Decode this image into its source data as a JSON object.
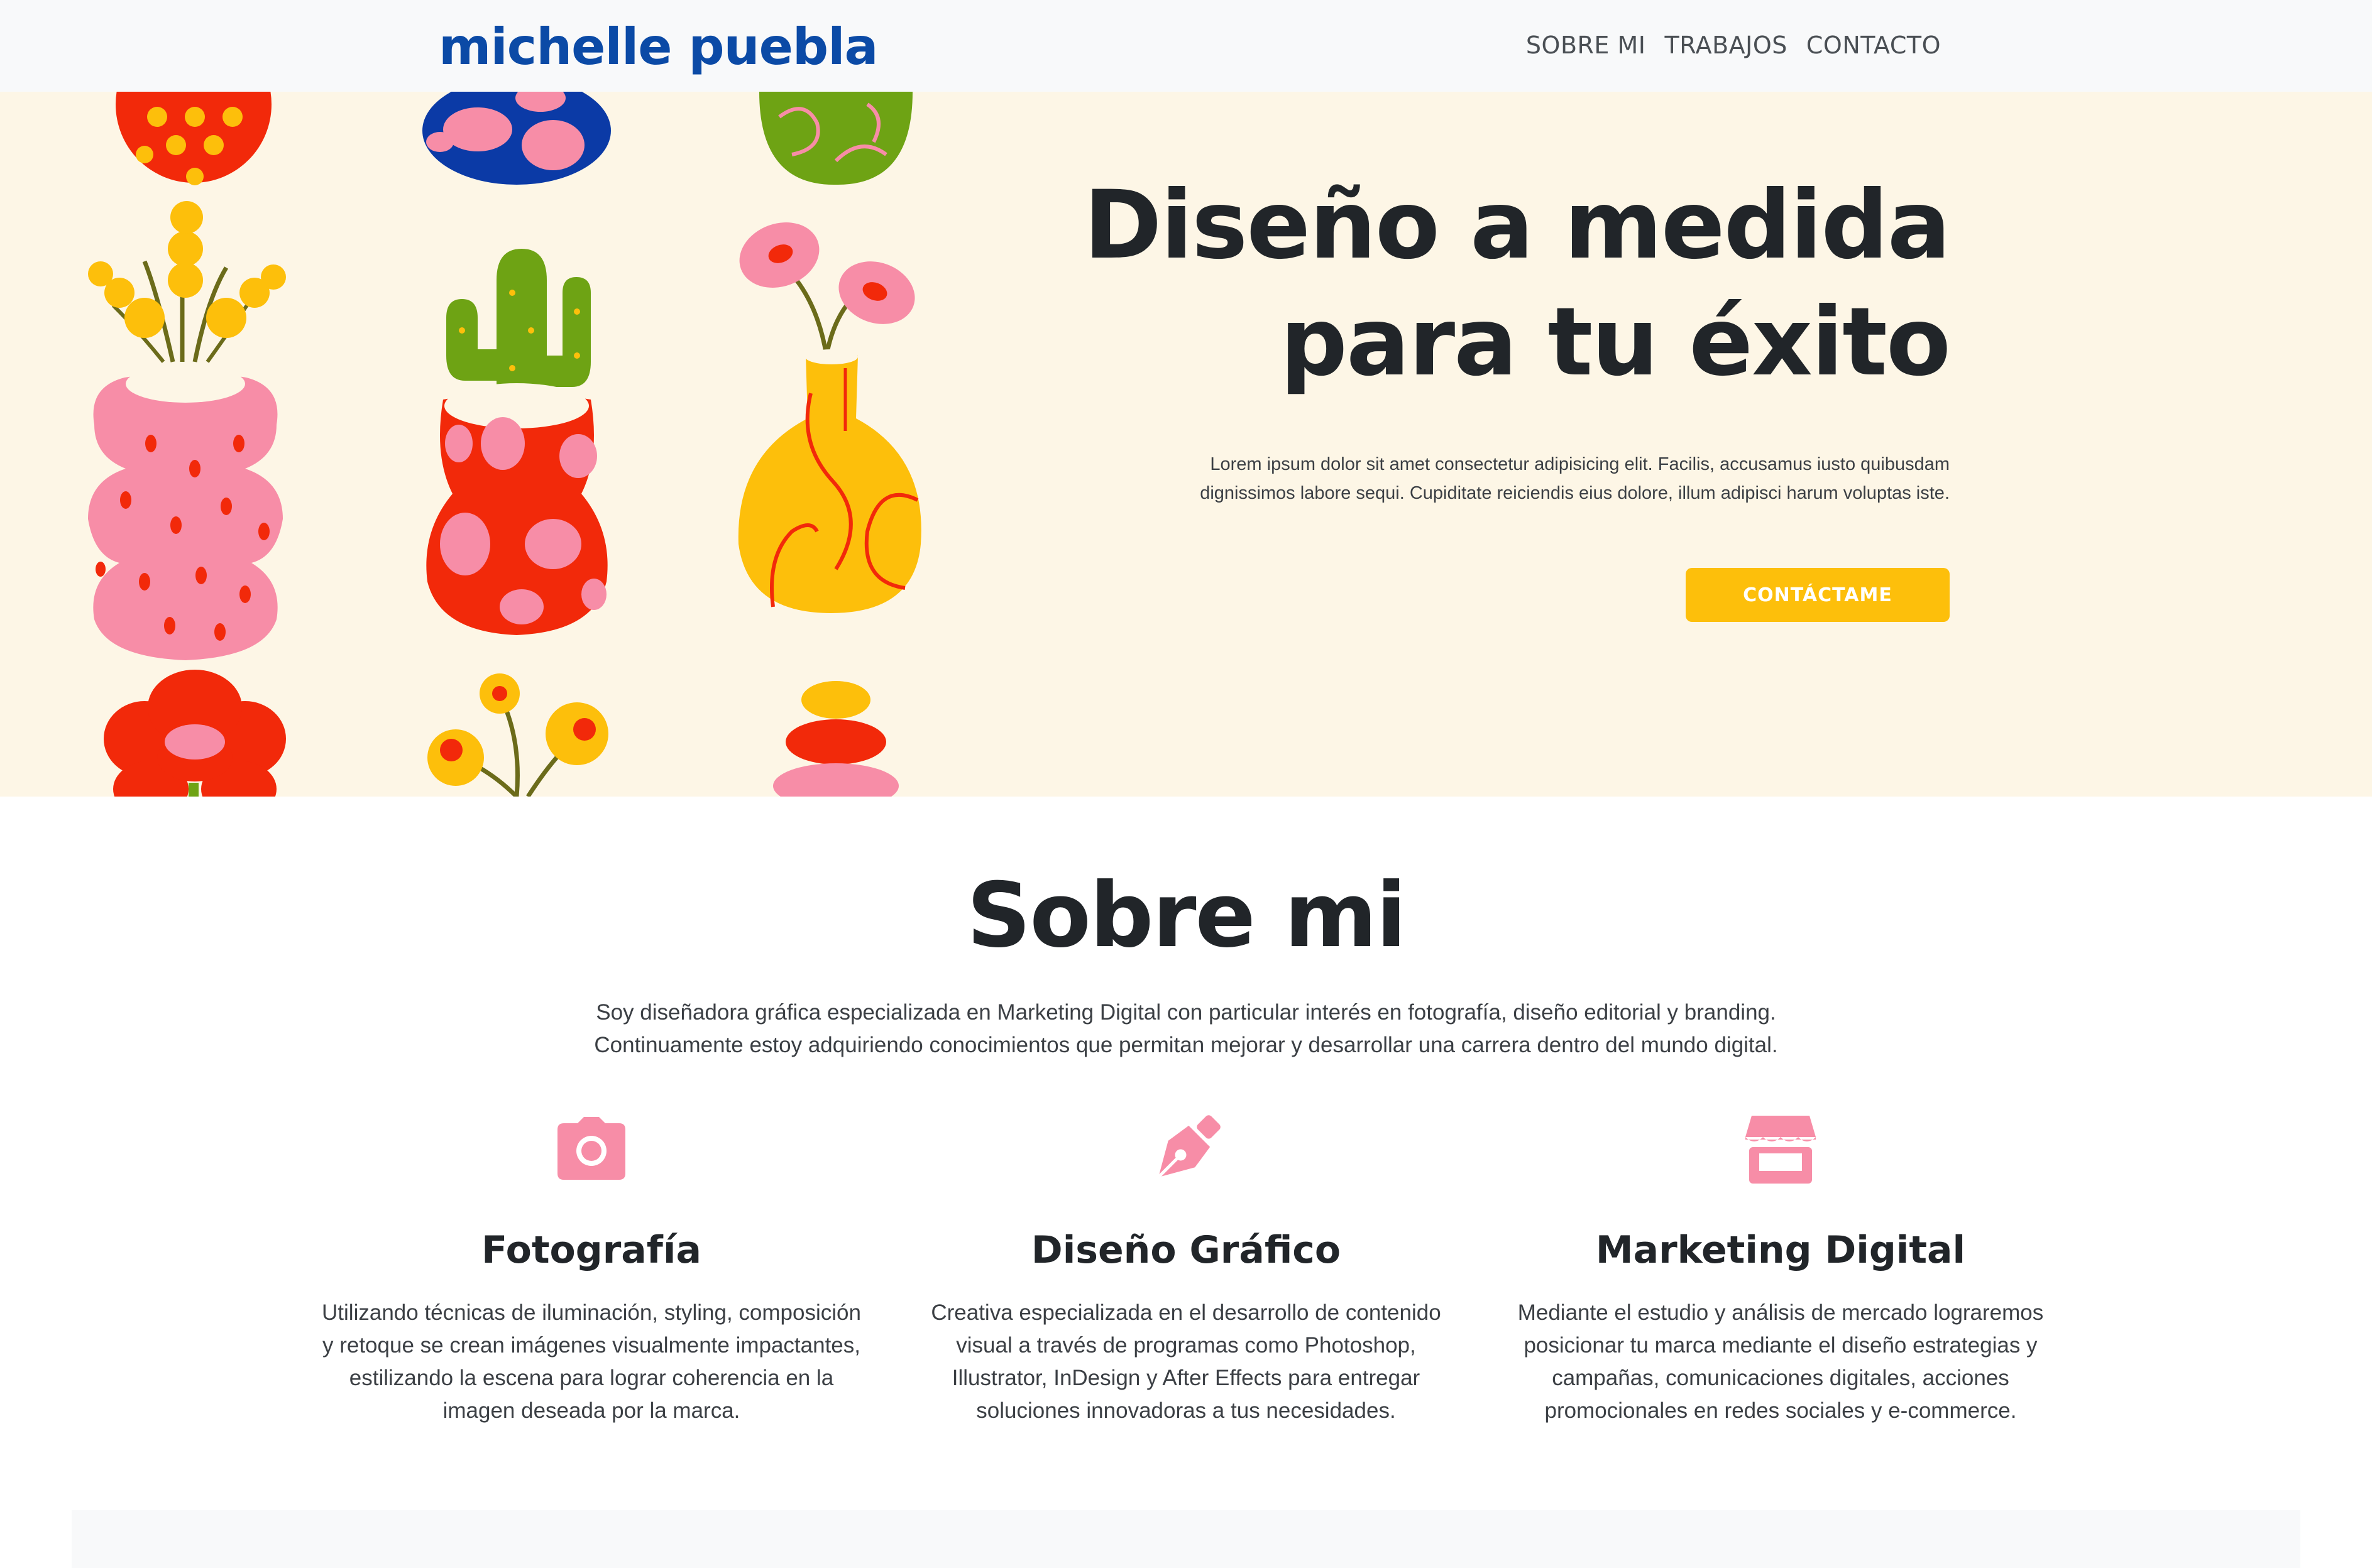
{
  "brand": {
    "logo": "michelle puebla",
    "logo_color": "#0b4aa6"
  },
  "nav": {
    "items": [
      "SOBRE MI",
      "TRABAJOS",
      "CONTACTO"
    ]
  },
  "hero": {
    "title_line1": "Diseño a medida",
    "title_line2": "para tu éxito",
    "text_line1": "Lorem ipsum dolor sit amet consectetur adipisicing elit. Facilis, accusamus iusto quibusdam",
    "text_line2": "dignissimos labore sequi. Cupiditate reiciendis eius dolore, illum adipisci harum voluptas iste.",
    "button_label": "CONTÁCTAME",
    "button_color": "#fdbf0b",
    "background_color": "#fdf6e6"
  },
  "about": {
    "title": "Sobre mi",
    "text_line1": "Soy diseñadora gráfica especializada en Marketing Digital con particular interés en fotografía, diseño editorial y branding.",
    "text_line2": "Continuamente estoy adquiriendo conocimientos que permitan mejorar y desarrollar una carrera dentro del mundo digital.",
    "icon_color": "#f78da7",
    "features": [
      {
        "icon": "camera-icon",
        "title": "Fotografía",
        "lines": [
          "Utilizando técnicas de iluminación, styling, composición",
          "y retoque se crean imágenes visualmente impactantes,",
          "estilizando la escena para lograr coherencia en la",
          "imagen deseada por la marca."
        ]
      },
      {
        "icon": "pen-nib-icon",
        "title": "Diseño Gráfico",
        "lines": [
          "Creativa especializada en el desarrollo de contenido",
          "visual a través de programas como Photoshop,",
          "Illustrator, InDesign y After Effects para entregar",
          "soluciones innovadoras a tus necesidades."
        ]
      },
      {
        "icon": "store-icon",
        "title": "Marketing Digital",
        "lines": [
          "Mediante el estudio y análisis de mercado lograremos",
          "posicionar tu marca mediante el diseño estrategias y",
          "campañas, comunicaciones digitales, acciones",
          "promocionales en redes sociales y e-commerce."
        ]
      }
    ]
  }
}
